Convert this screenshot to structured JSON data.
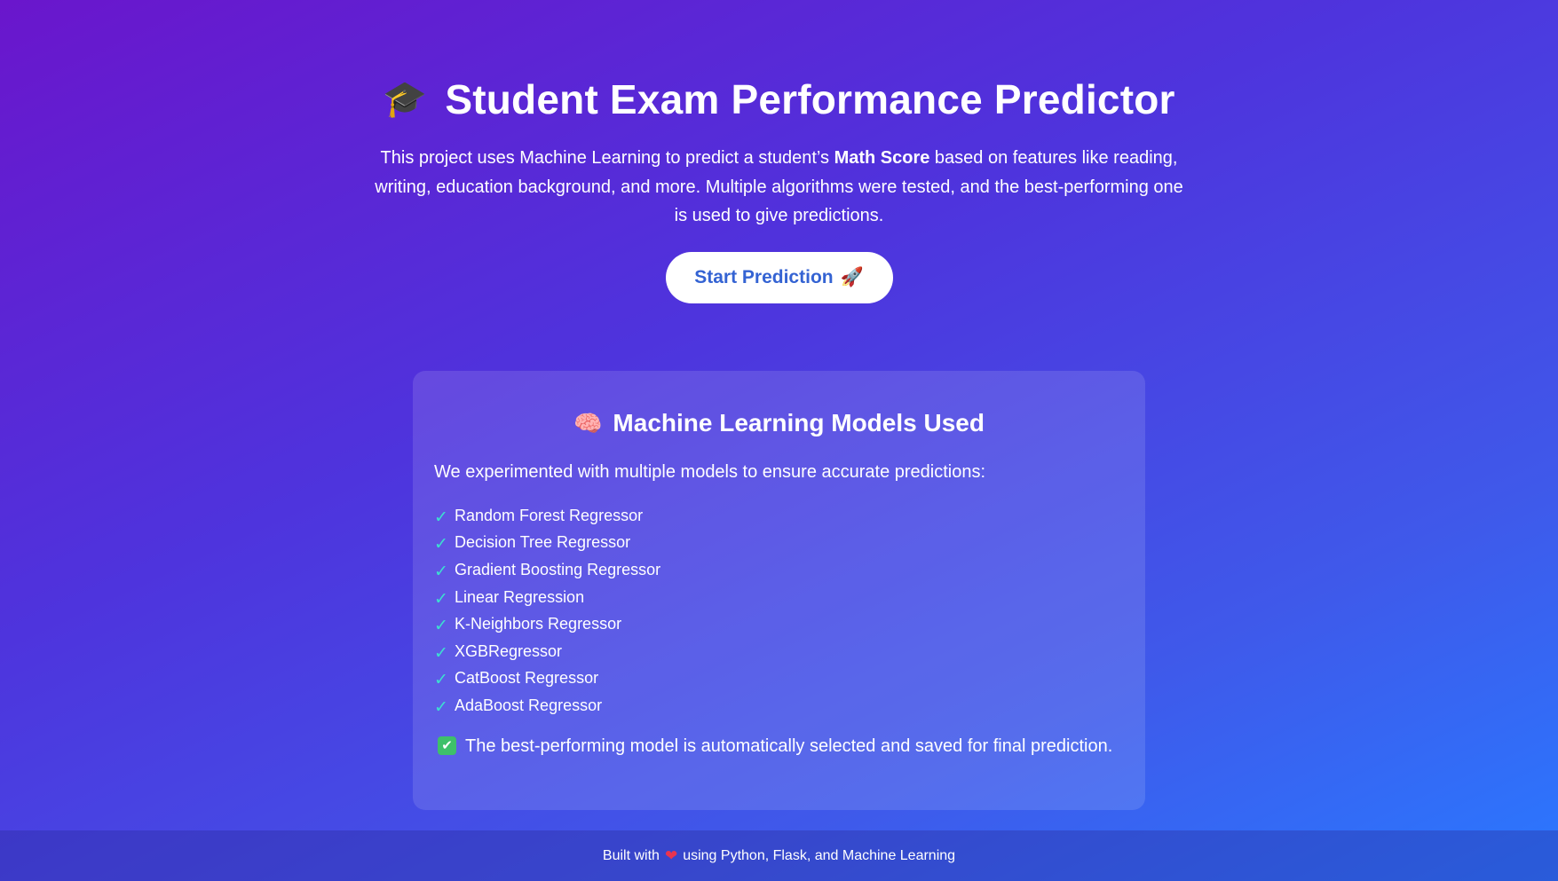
{
  "hero": {
    "title_icon": "🎓",
    "title": "Student Exam Performance Predictor",
    "desc_before": "This project uses Machine Learning to predict a student’s ",
    "desc_bold": "Math Score",
    "desc_after": " based on features like reading, writing, education background, and more. Multiple algorithms were tested, and the best-performing one is used to give predictions.",
    "cta_label": "Start Prediction",
    "cta_icon": "🚀"
  },
  "models": {
    "title_icon": "🧠",
    "title": "Machine Learning Models Used",
    "intro": "We experimented with multiple models to ensure accurate predictions:",
    "check_glyph": "✓",
    "items": [
      "Random Forest Regressor",
      "Decision Tree Regressor",
      "Gradient Boosting Regressor",
      "Linear Regression",
      "K-Neighbors Regressor",
      "XGBRegressor",
      "CatBoost Regressor",
      "AdaBoost Regressor"
    ],
    "note_icon": "✔",
    "note": "The best-performing model is automatically selected and saved for final prediction."
  },
  "footer": {
    "before": "Built with",
    "heart": "❤",
    "after": "using Python, Flask, and Machine Learning"
  },
  "colors": {
    "gradient_start": "#6a16cc",
    "gradient_end": "#2a78ff",
    "cta_text": "#3463d3",
    "check": "#3ce0d0"
  }
}
